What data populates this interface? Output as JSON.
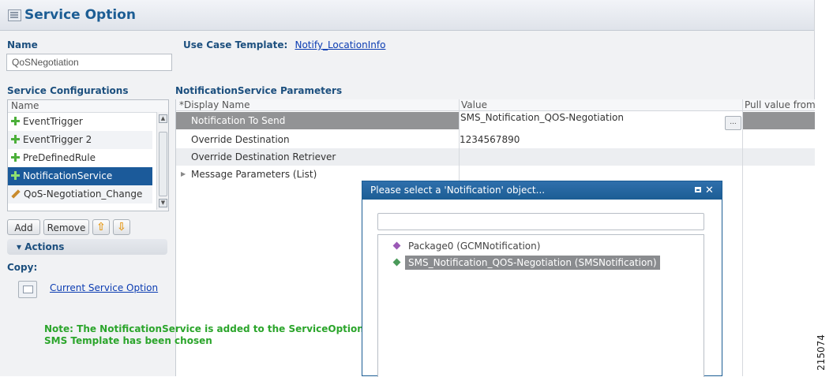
{
  "header": {
    "title": "Service Option",
    "icon": "service-option-icon"
  },
  "name_section": {
    "label": "Name",
    "value": "QoSNegotiation"
  },
  "use_case": {
    "label": "Use Case Template:",
    "link": "Notify_LocationInfo"
  },
  "service_configurations": {
    "label": "Service Configurations",
    "column": "Name",
    "items": [
      {
        "label": "EventTrigger",
        "icon": "plus-icon"
      },
      {
        "label": "EventTrigger 2",
        "icon": "plus-icon"
      },
      {
        "label": "PreDefinedRule",
        "icon": "plus-icon"
      },
      {
        "label": "NotificationService",
        "icon": "plus-icon"
      },
      {
        "label": "QoS-Negotiation_Change",
        "icon": "pencil-icon"
      }
    ],
    "buttons": {
      "add": "Add",
      "remove": "Remove",
      "up": "⇧",
      "down": "⇩"
    }
  },
  "actions": {
    "label": "Actions",
    "copy_label": "Copy:",
    "copy_link": "Current Service Option"
  },
  "parameters": {
    "label": "NotificationService Parameters",
    "columns": {
      "display_name": "*Display Name",
      "value": "Value",
      "pull": "Pull value from"
    },
    "rows": [
      {
        "name": "Notification To Send",
        "value": "SMS_Notification_QOS-Negotiation"
      },
      {
        "name": "Override Destination",
        "value": "1234567890"
      },
      {
        "name": "Override Destination Retriever",
        "value": ""
      },
      {
        "name": "Message Parameters (List)",
        "value": ""
      }
    ],
    "dots_button": "..."
  },
  "dialog": {
    "title": "Please select a 'Notification' object...",
    "search_value": "",
    "items": [
      {
        "label": "Package0 (GCMNotification)",
        "color": "#9b59b6"
      },
      {
        "label": "SMS_Notification_QOS-Negotiation (SMSNotification)",
        "color": "#4a9a5a"
      }
    ]
  },
  "note": {
    "line1": "Note: The NotificationService is added to the ServiceOption QoSNegotiation , wherein the",
    "line2": "SMS Template has been chosen"
  },
  "figure_id": "215074",
  "colors": {
    "accent": "#1c5d94",
    "selection": "#1b5a9a",
    "note": "#2ba52b"
  }
}
